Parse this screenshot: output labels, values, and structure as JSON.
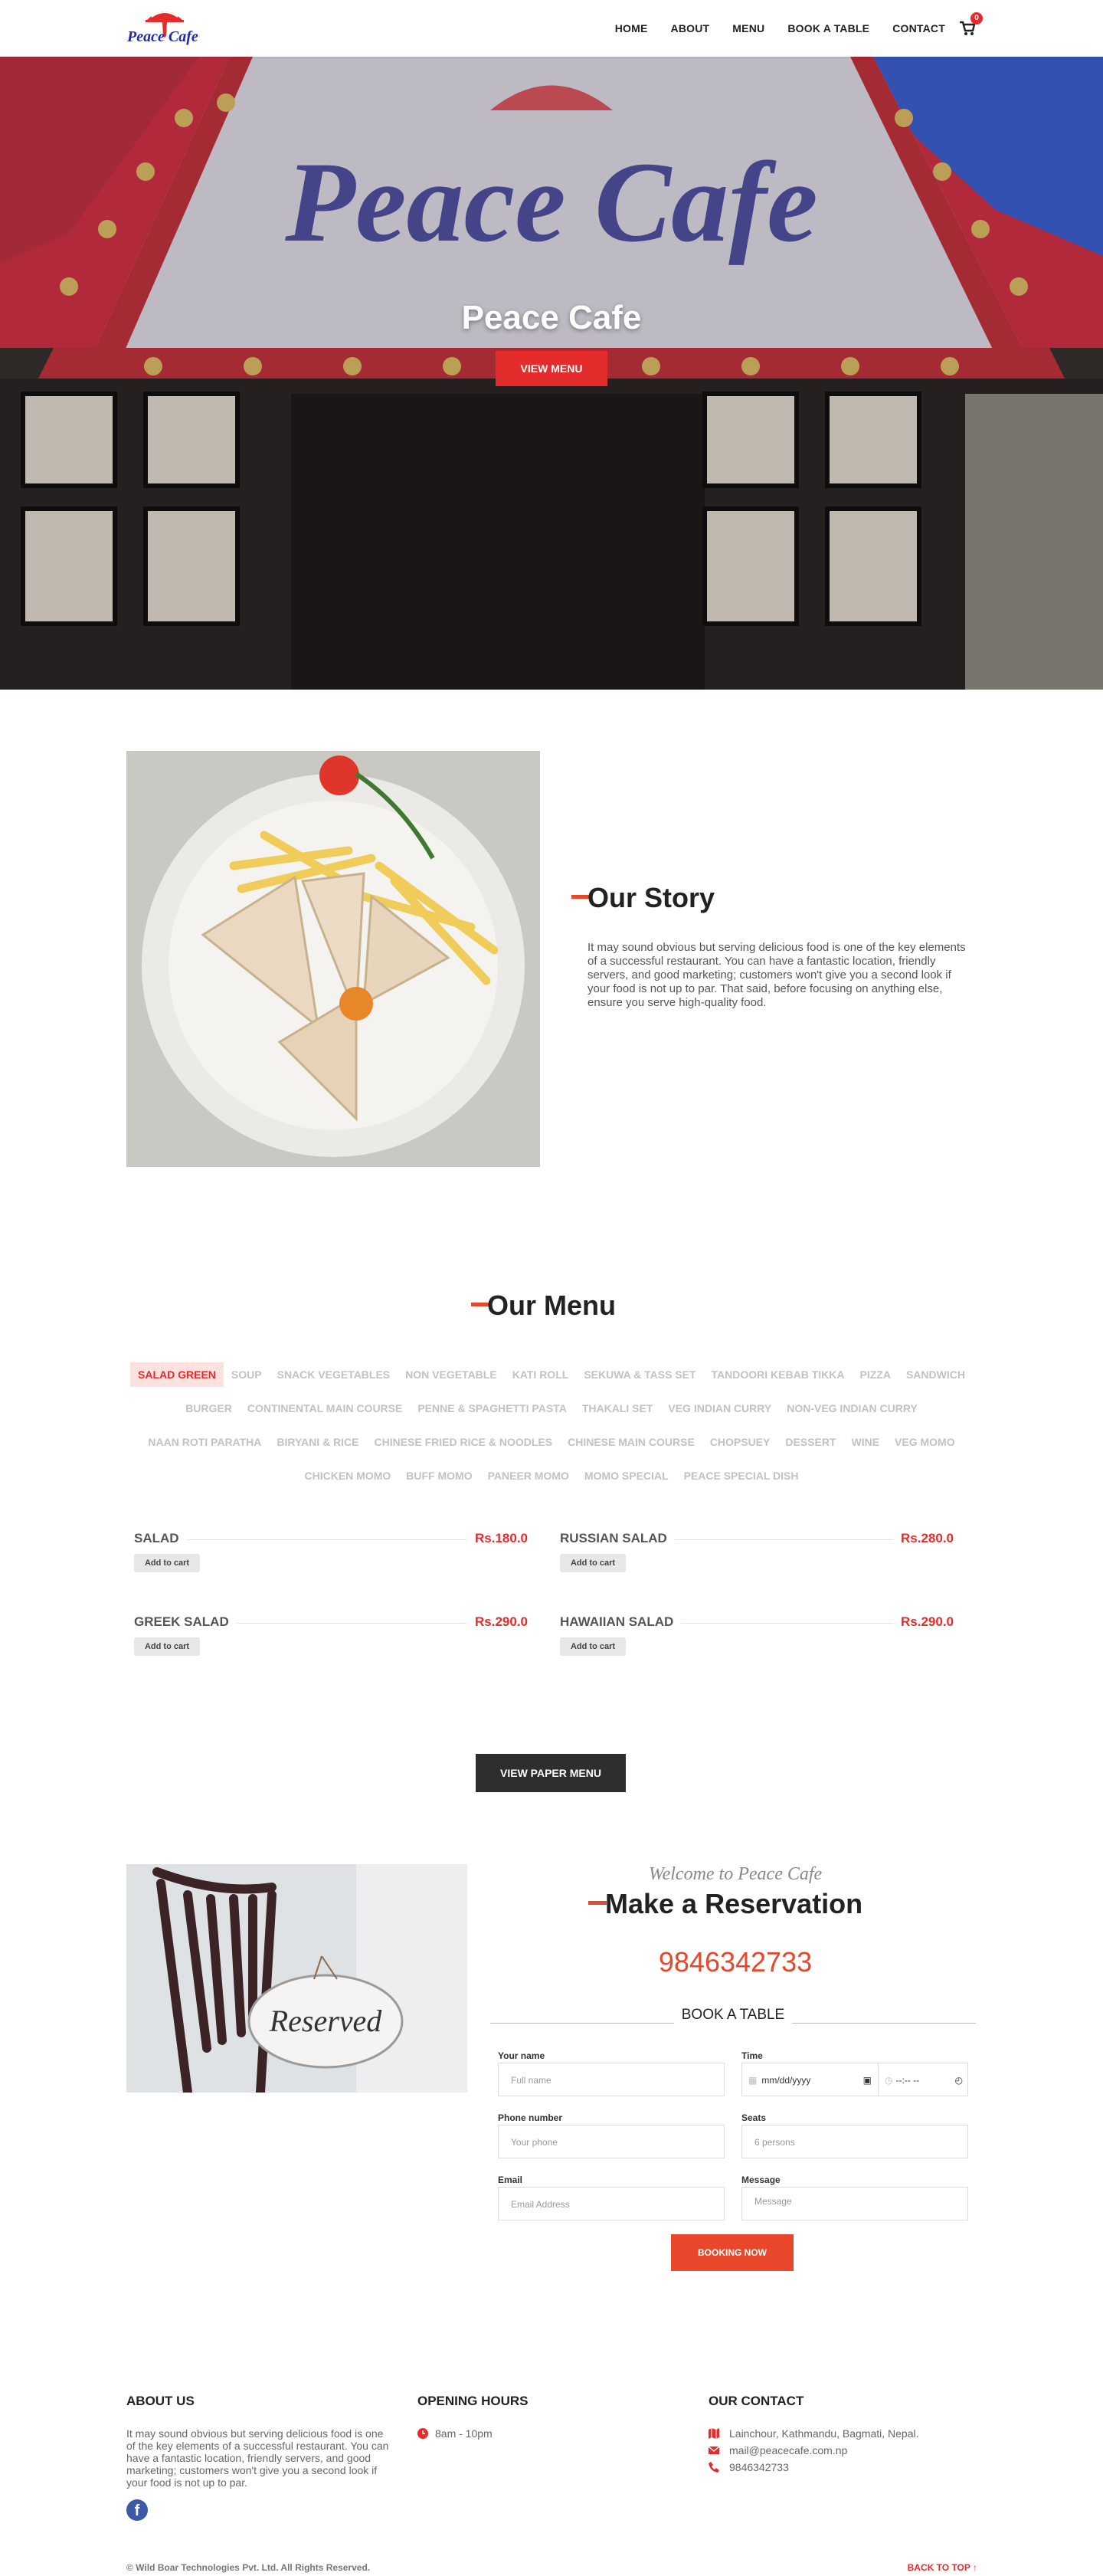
{
  "header": {
    "logo_text": "Peace Cafe",
    "nav": [
      "HOME",
      "ABOUT",
      "MENU",
      "BOOK A TABLE",
      "CONTACT"
    ],
    "cart_count": "0",
    "colors": {
      "accent": "#e52c2c",
      "logo_blue": "#1f2bb0"
    }
  },
  "hero": {
    "sign_text": "Peace Cafe",
    "title": "Peace Cafe",
    "button": "VIEW MENU"
  },
  "story": {
    "title": "Our Story",
    "text": "It may sound obvious but serving delicious food is one of the key elements of a successful restaurant. You can have a fantastic location, friendly servers, and good marketing; customers won't give you a second look if your food is not up to par. That said, before focusing on anything else, ensure you serve high-quality food."
  },
  "menu": {
    "title": "Our Menu",
    "categories": [
      "SALAD GREEN",
      "SOUP",
      "SNACK VEGETABLES",
      "NON VEGETABLE",
      "KATI ROLL",
      "SEKUWA & TASS SET",
      "TANDOORI KEBAB TIKKA",
      "PIZZA",
      "SANDWICH",
      "BURGER",
      "CONTINENTAL MAIN COURSE",
      "PENNE & SPAGHETTI PASTA",
      "THAKALI SET",
      "VEG INDIAN CURRY",
      "NON-VEG INDIAN CURRY",
      "NAAN ROTI PARATHA",
      "BIRYANI & RICE",
      "CHINESE FRIED RICE & NOODLES",
      "CHINESE MAIN COURSE",
      "CHOPSUEY",
      "DESSERT",
      "WINE",
      "VEG MOMO",
      "CHICKEN MOMO",
      "BUFF MOMO",
      "PANEER MOMO",
      "MOMO SPECIAL",
      "PEACE SPECIAL DISH"
    ],
    "active_category": "SALAD GREEN",
    "items": [
      {
        "name": "SALAD",
        "price": "Rs.180.0",
        "button": "Add to cart"
      },
      {
        "name": "RUSSIAN SALAD",
        "price": "Rs.280.0",
        "button": "Add to cart"
      },
      {
        "name": "GREEK SALAD",
        "price": "Rs.290.0",
        "button": "Add to cart"
      },
      {
        "name": "HAWAIIAN SALAD",
        "price": "Rs.290.0",
        "button": "Add to cart"
      }
    ],
    "paper_button": "VIEW PAPER MENU"
  },
  "reservation": {
    "chair_sign": "Reserved",
    "welcome": "Welcome to Peace Cafe",
    "title": "Make a Reservation",
    "phone": "9846342733",
    "book_label": "BOOK A TABLE",
    "fields": {
      "name_label": "Your name",
      "name_placeholder": "Full name",
      "time_label": "Time",
      "date_placeholder": "mm/dd/yyyy",
      "time_placeholder": "--:-- --",
      "phone_label": "Phone number",
      "phone_placeholder": "Your phone",
      "seats_label": "Seats",
      "seats_value": "6 persons",
      "email_label": "Email",
      "email_placeholder": "Email Address",
      "message_label": "Message",
      "message_placeholder": "Message"
    },
    "button": "BOOKING NOW"
  },
  "footer": {
    "about_title": "ABOUT US",
    "about_text": "It may sound obvious but serving delicious food is one of the key elements of a successful restaurant. You can have a fantastic location, friendly servers, and good marketing; customers won't give you a second look if your food is not up to par.",
    "hours_title": "OPENING HOURS",
    "hours": "8am - 10pm",
    "contact_title": "OUR CONTACT",
    "address": "Lainchour, Kathmandu, Bagmati, Nepal.",
    "email": "mail@peacecafe.com.np",
    "phone": "9846342733",
    "copyright": "© Wild Boar Technologies Pvt. Ltd. All Rights Reserved.",
    "back_to_top": "BACK TO TOP ↑"
  }
}
